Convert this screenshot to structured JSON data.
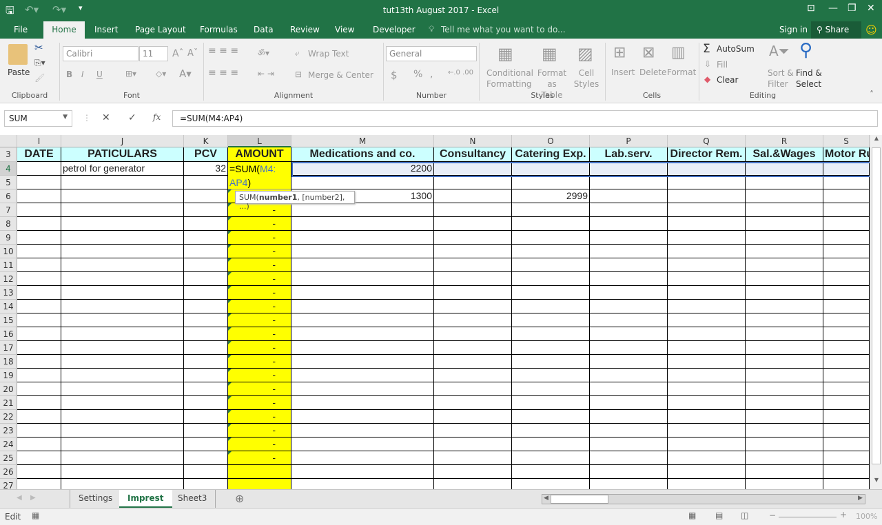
{
  "window": {
    "title": "tut13th August 2017 - Excel"
  },
  "ribbon_tabs": [
    "File",
    "Home",
    "Insert",
    "Page Layout",
    "Formulas",
    "Data",
    "Review",
    "View",
    "Developer"
  ],
  "tell_me": "Tell me what you want to do...",
  "sign_in": "Sign in",
  "share": "Share",
  "ribbon": {
    "paste": "Paste",
    "font_name": "Calibri",
    "font_size": "11",
    "bold": "B",
    "italic": "I",
    "underline": "U",
    "wrap_text": "Wrap Text",
    "merge_center": "Merge & Center",
    "number_format": "General",
    "currency": "$",
    "percent": "%",
    "comma": ",",
    "conditional_formatting": [
      "Conditional",
      "Formatting"
    ],
    "format_as_table": [
      "Format as",
      "Table"
    ],
    "cell_styles": [
      "Cell",
      "Styles"
    ],
    "insert": "Insert",
    "delete": "Delete",
    "format": "Format",
    "autosum": "AutoSum",
    "fill": "Fill",
    "clear": "Clear",
    "sort_filter": [
      "Sort &",
      "Filter"
    ],
    "find_select": [
      "Find &",
      "Select"
    ],
    "groups": [
      "Clipboard",
      "Font",
      "Alignment",
      "Number",
      "Styles",
      "Cells",
      "Editing"
    ]
  },
  "formula_bar": {
    "name_box": "SUM",
    "fx": "fx",
    "formula": "=SUM(M4:AP4)"
  },
  "columns": [
    "I",
    "J",
    "K",
    "L",
    "M",
    "N",
    "O",
    "P",
    "Q",
    "R",
    "S"
  ],
  "headers": [
    "DATE",
    "PATICULARS",
    "PCV",
    "AMOUNT",
    "Medications and co.",
    "Consultancy",
    "Catering Exp.",
    "Lab.serv.",
    "Director Rem.",
    "Sal.&Wages",
    "Motor Ru"
  ],
  "rows": [
    {
      "num": "3"
    },
    {
      "num": "4",
      "J": "petrol for generator",
      "K": "32",
      "L1": "=SUM(",
      "L2": "M4:",
      "L3": "AP4",
      "L4": ")",
      "M": "2200"
    },
    {
      "num": "5"
    },
    {
      "num": "6",
      "M": "1300",
      "O": "2999"
    },
    {
      "num": "7",
      "L": "-"
    },
    {
      "num": "8",
      "L": "-"
    },
    {
      "num": "9",
      "L": "-"
    },
    {
      "num": "10",
      "L": "-"
    },
    {
      "num": "11",
      "L": "-"
    },
    {
      "num": "12",
      "L": "-"
    },
    {
      "num": "13",
      "L": "-"
    },
    {
      "num": "14",
      "L": "-"
    },
    {
      "num": "15",
      "L": "-"
    },
    {
      "num": "16",
      "L": "-"
    },
    {
      "num": "17",
      "L": "-"
    },
    {
      "num": "18",
      "L": "-"
    },
    {
      "num": "19",
      "L": "-"
    },
    {
      "num": "20",
      "L": "-"
    },
    {
      "num": "21",
      "L": "-"
    },
    {
      "num": "22",
      "L": "-"
    },
    {
      "num": "23",
      "L": "-"
    },
    {
      "num": "24",
      "L": "-"
    },
    {
      "num": "25",
      "L": "-"
    },
    {
      "num": "26"
    },
    {
      "num": "27"
    }
  ],
  "tooltip": {
    "prefix": "SUM(",
    "bold": "number1",
    "rest": ", [number2], ...)"
  },
  "sheets": [
    "Settings",
    "Imprest",
    "Sheet3"
  ],
  "active_sheet": "Imprest",
  "status": {
    "mode": "Edit",
    "zoom": "100%"
  },
  "colors": {
    "brand": "#217346",
    "header_fill": "#ccffff",
    "amount_fill": "#ffff00",
    "selection_fill": "#e8eef8",
    "ref_blue": "#4472c4"
  }
}
